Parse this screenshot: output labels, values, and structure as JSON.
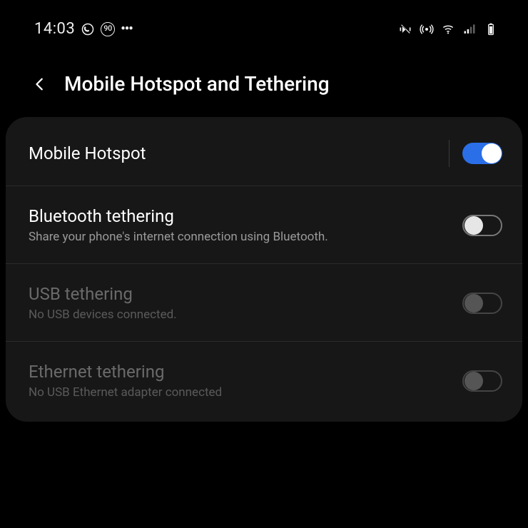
{
  "status": {
    "time": "14:03",
    "badge": "90"
  },
  "header": {
    "title": "Mobile Hotspot and Tethering"
  },
  "rows": {
    "hotspot": {
      "title": "Mobile Hotspot"
    },
    "bt": {
      "title": "Bluetooth tethering",
      "sub": "Share your phone's internet connection using Bluetooth."
    },
    "usb": {
      "title": "USB tethering",
      "sub": "No USB devices connected."
    },
    "eth": {
      "title": "Ethernet tethering",
      "sub": "No USB Ethernet adapter connected"
    }
  }
}
